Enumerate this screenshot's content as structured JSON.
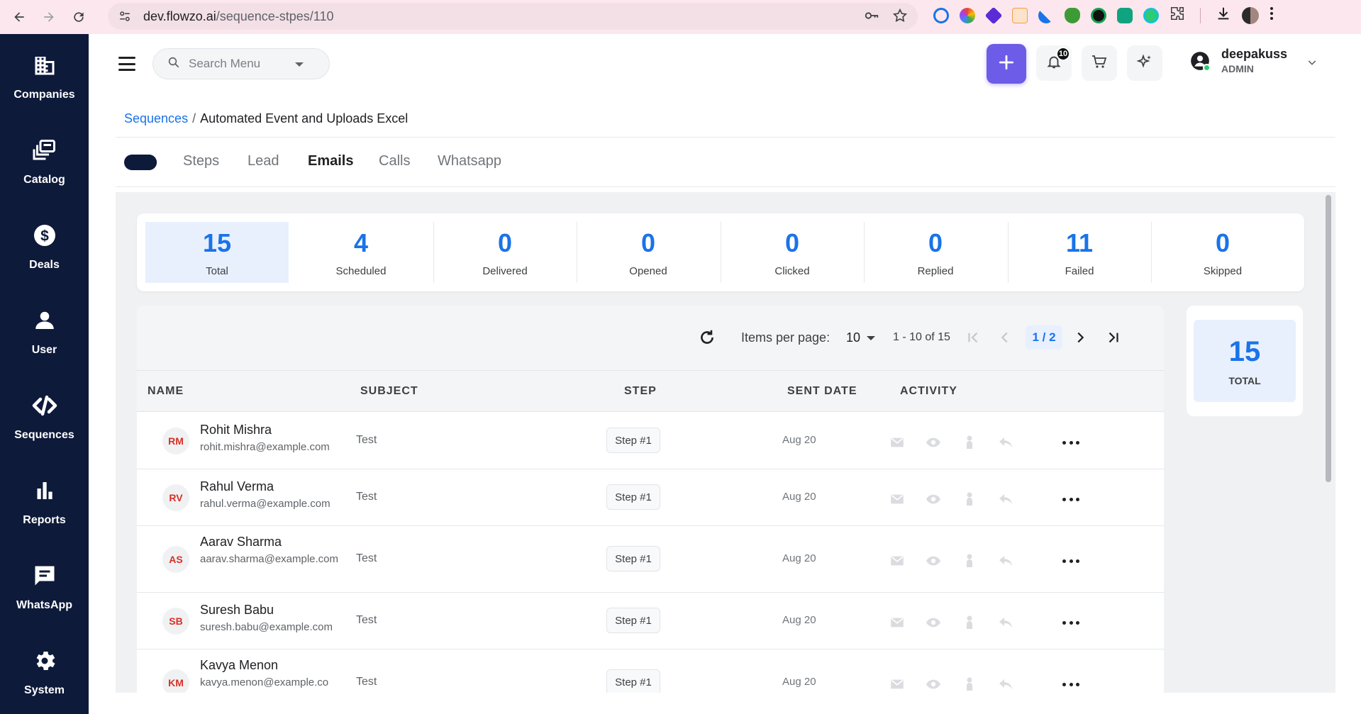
{
  "browser": {
    "url_host": "dev.flowzo.ai",
    "url_path": "/sequence-stpes/110"
  },
  "sidebar": {
    "items": [
      {
        "label": "Companies",
        "icon": "building-icon"
      },
      {
        "label": "Catalog",
        "icon": "catalog-icon"
      },
      {
        "label": "Deals",
        "icon": "dollar-icon"
      },
      {
        "label": "User",
        "icon": "person-icon"
      },
      {
        "label": "Sequences",
        "icon": "code-icon"
      },
      {
        "label": "Reports",
        "icon": "bar-chart-icon"
      },
      {
        "label": "WhatsApp",
        "icon": "chat-icon"
      },
      {
        "label": "System",
        "icon": "gear-icon"
      }
    ]
  },
  "header": {
    "search_placeholder": "Search Menu",
    "notification_count": "10",
    "user_name": "deepakuss",
    "user_role": "ADMIN"
  },
  "breadcrumb": {
    "parent": "Sequences",
    "separator": "/",
    "current": "Automated Event and Uploads Excel"
  },
  "tabs": [
    {
      "label": "Steps",
      "active": false
    },
    {
      "label": "Lead",
      "active": false
    },
    {
      "label": "Emails",
      "active": true
    },
    {
      "label": "Calls",
      "active": false
    },
    {
      "label": "Whatsapp",
      "active": false
    }
  ],
  "stats": [
    {
      "value": "15",
      "label": "Total"
    },
    {
      "value": "4",
      "label": "Scheduled"
    },
    {
      "value": "0",
      "label": "Delivered"
    },
    {
      "value": "0",
      "label": "Opened"
    },
    {
      "value": "0",
      "label": "Clicked"
    },
    {
      "value": "0",
      "label": "Replied"
    },
    {
      "value": "11",
      "label": "Failed"
    },
    {
      "value": "0",
      "label": "Skipped"
    }
  ],
  "pagination": {
    "items_per_page_label": "Items per page:",
    "items_per_page": "10",
    "range": "1 - 10 of 15",
    "page": "1 / 2"
  },
  "table": {
    "columns": [
      "NAME",
      "SUBJECT",
      "STEP",
      "SENT DATE",
      "ACTIVITY"
    ],
    "rows": [
      {
        "initials": "RM",
        "name": "Rohit Mishra",
        "email": "rohit.mishra@example.com",
        "subject": "Test",
        "step": "Step #1",
        "sent": "Aug 20"
      },
      {
        "initials": "RV",
        "name": "Rahul Verma",
        "email": "rahul.verma@example.com",
        "subject": "Test",
        "step": "Step #1",
        "sent": "Aug 20"
      },
      {
        "initials": "AS",
        "name": "Aarav Sharma",
        "email": "aarav.sharma@example.com",
        "subject": "Test",
        "step": "Step #1",
        "sent": "Aug 20"
      },
      {
        "initials": "SB",
        "name": "Suresh Babu",
        "email": "suresh.babu@example.com",
        "subject": "Test",
        "step": "Step #1",
        "sent": "Aug 20"
      },
      {
        "initials": "KM",
        "name": "Kavya Menon",
        "email": "kavya.menon@example.co",
        "subject": "Test",
        "step": "Step #1",
        "sent": "Aug 20"
      }
    ]
  },
  "total_card": {
    "value": "15",
    "label": "TOTAL"
  },
  "colors": {
    "sidebar_bg": "#0e1a3a",
    "accent_blue": "#1a73e8",
    "plus_button": "#6c5ce7",
    "avatar_text": "#d93025"
  }
}
